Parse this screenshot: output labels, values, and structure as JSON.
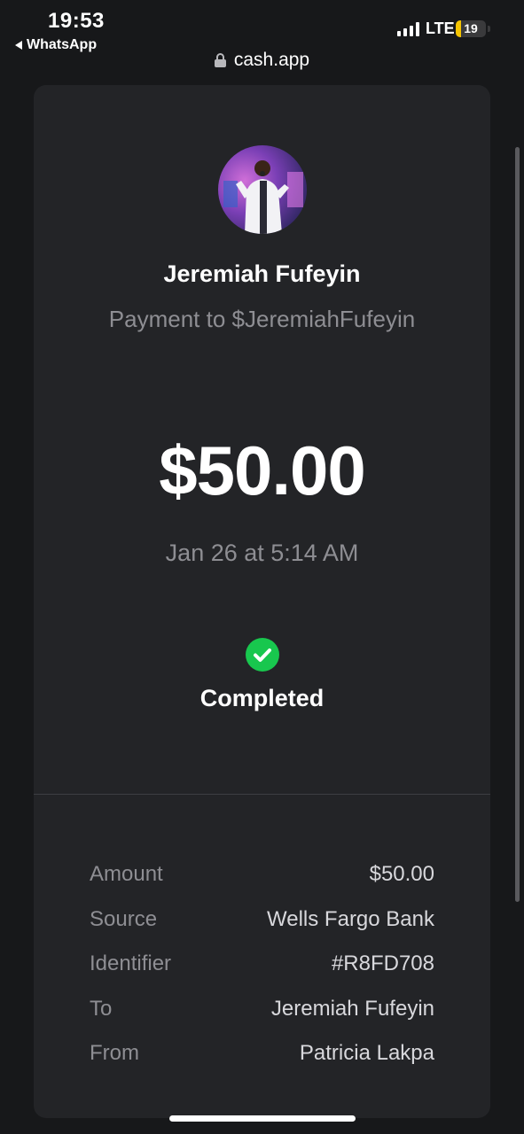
{
  "status_bar": {
    "time": "19:53",
    "back_app": "WhatsApp",
    "network": "LTE",
    "battery_level": "19",
    "battery_fraction": 0.19
  },
  "browser": {
    "url": "cash.app"
  },
  "payment": {
    "recipient_name": "Jeremiah Fufeyin",
    "subtitle": "Payment to $JeremiahFufeyin",
    "amount": "$50.00",
    "date": "Jan 26 at 5:14 AM",
    "status": "Completed"
  },
  "details": [
    {
      "label": "Amount",
      "value": "$50.00"
    },
    {
      "label": "Source",
      "value": "Wells Fargo Bank"
    },
    {
      "label": "Identifier",
      "value": "#R8FD708"
    },
    {
      "label": "To",
      "value": "Jeremiah Fufeyin"
    },
    {
      "label": "From",
      "value": "Patricia Lakpa"
    }
  ],
  "colors": {
    "background": "#17181a",
    "card": "#232427",
    "success": "#18c74e",
    "muted_text": "#8e8e93",
    "battery_low": "#f5c400"
  },
  "icons": {
    "lock": "lock-icon",
    "back": "back-arrow-icon",
    "status": "check-circle-icon",
    "signal": "signal-bars-icon",
    "battery": "battery-icon"
  }
}
